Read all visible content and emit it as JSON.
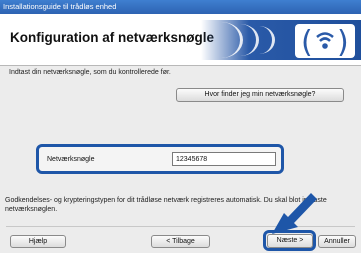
{
  "window": {
    "title": "Installationsguide til trådløs enhed"
  },
  "header": {
    "title": "Konfiguration af netværksnøgle",
    "icon": "wifi-icon",
    "accent": "#1e56a8"
  },
  "instruction": "Indtast din netværksnøgle, som du kontrollerede før.",
  "help_link_button": "Hvor finder jeg min netværksnøgle?",
  "network_key": {
    "label": "Netværksnøgle",
    "value": "12345678"
  },
  "info_text": "Godkendelses- og krypteringstypen for dit trådløse netværk registreres automatisk. Du skal blot indtaste netværksnøglen.",
  "buttons": {
    "help": "Hjælp",
    "back": "< Tilbage",
    "next": "Næste >",
    "cancel": "Annuller"
  },
  "annotation": {
    "arrow": "arrow-icon",
    "color": "#1e56a8"
  }
}
